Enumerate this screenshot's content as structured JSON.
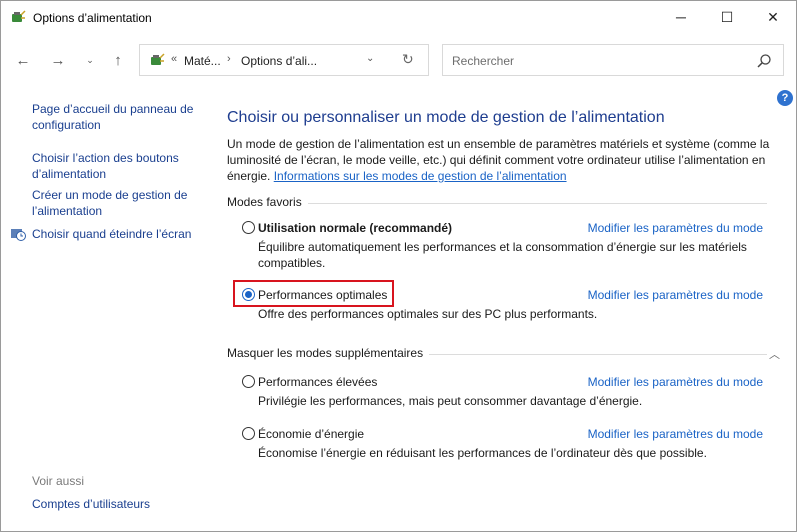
{
  "window": {
    "title": "Options d’alimentation",
    "minimize": "─",
    "maximize": "☐",
    "close": "✕"
  },
  "nav": {
    "back": "←",
    "forward": "→",
    "recent": "⌄",
    "up": "↑",
    "breadcrumb_sep": "«",
    "crumb_sep": "›",
    "crumbs": [
      "Maté...",
      "Options d’ali..."
    ],
    "dropdown": "⌄",
    "refresh": "↻"
  },
  "search": {
    "placeholder": "Rechercher"
  },
  "help": "?",
  "sidebar": {
    "items": [
      {
        "label": "Page d’accueil du panneau de configuration"
      },
      {
        "label": "Choisir l’action des boutons d’alimentation"
      },
      {
        "label": "Créer un mode de gestion de l’alimentation"
      },
      {
        "label": "Choisir quand éteindre l’écran"
      }
    ],
    "see_also": "Voir aussi",
    "see_also_items": [
      {
        "label": "Comptes d’utilisateurs"
      }
    ]
  },
  "main": {
    "title": "Choisir ou personnaliser un mode de gestion de l’alimentation",
    "description": "Un mode de gestion de l’alimentation est un ensemble de paramètres matériels et système (comme la luminosité de l’écran, le mode veille, etc.) qui définit comment votre ordinateur utilise l’alimentation en énergie.",
    "description_link": "Informations sur les modes de gestion de l’alimentation",
    "favorites_label": "Modes favoris",
    "extra_label": "Masquer les modes supplémentaires",
    "collapse": "︿",
    "change_link": "Modifier les paramètres du mode",
    "plans": [
      {
        "name": "Utilisation normale (recommandé)",
        "desc": "Équilibre automatiquement les performances et la consommation d’énergie sur les matériels compatibles.",
        "selected": false
      },
      {
        "name": "Performances optimales",
        "desc": "Offre des performances optimales sur des PC plus performants.",
        "selected": true
      },
      {
        "name": "Performances élevées",
        "desc": "Privilégie les performances, mais peut consommer davantage d’énergie.",
        "selected": false
      },
      {
        "name": "Économie d’énergie",
        "desc": "Économise l’énergie en réduisant les performances de l’ordinateur dès que possible.",
        "selected": false
      }
    ]
  },
  "colors": {
    "link": "#1a63c6",
    "nav_link": "#1a3f8f",
    "title": "#1e3d8f",
    "highlight": "#d8141e"
  }
}
